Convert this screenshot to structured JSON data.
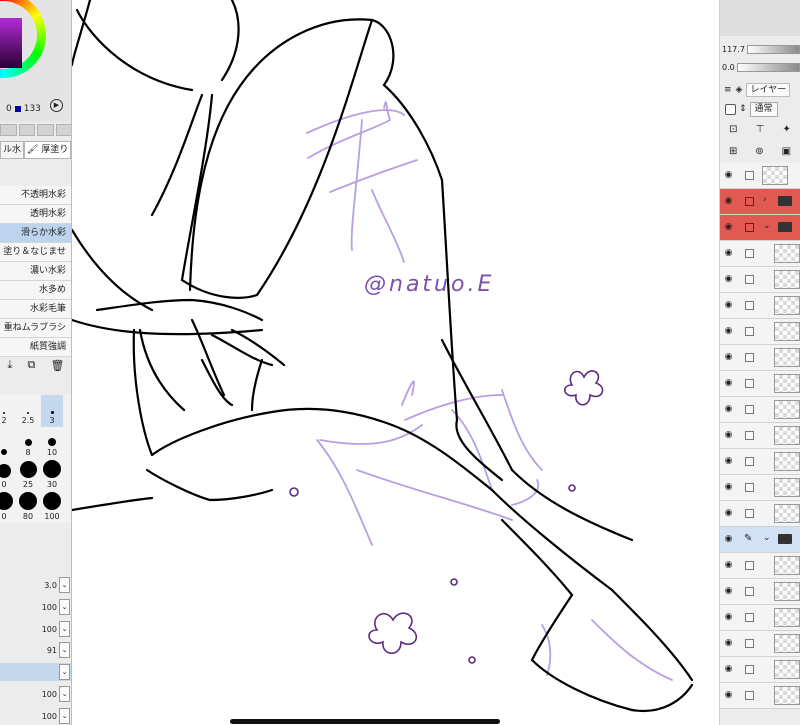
{
  "color_panel": {
    "value_left": "0",
    "value_right": "133",
    "hue_color": "#b22bd6"
  },
  "brush_types": [
    "ル水",
    "厚塗り"
  ],
  "brushes": [
    {
      "label": "不透明水彩",
      "selected": false
    },
    {
      "label": "透明水彩",
      "selected": false
    },
    {
      "label": "滑らか水彩",
      "selected": true
    },
    {
      "label": "塗り＆なじませ",
      "selected": false
    },
    {
      "label": "濃い水彩",
      "selected": false
    },
    {
      "label": "水多め",
      "selected": false
    },
    {
      "label": "水彩毛筆",
      "selected": false
    },
    {
      "label": "重ねムラブラシ",
      "selected": false
    },
    {
      "label": "紙質強調",
      "selected": false
    }
  ],
  "brush_sizes": [
    {
      "label": "2",
      "selected": false
    },
    {
      "label": "2.5",
      "selected": false
    },
    {
      "label": "3",
      "selected": true
    },
    {
      "label": "",
      "selected": false
    },
    {
      "label": "8",
      "selected": false
    },
    {
      "label": "10",
      "selected": false
    },
    {
      "label": "0",
      "selected": false
    },
    {
      "label": "25",
      "selected": false
    },
    {
      "label": "30",
      "selected": false
    },
    {
      "label": "0",
      "selected": false
    },
    {
      "label": "80",
      "selected": false
    },
    {
      "label": "100",
      "selected": false
    }
  ],
  "tool_props": [
    {
      "value": "3.0",
      "selected": false
    },
    {
      "value": "100",
      "selected": false
    },
    {
      "value": "100",
      "selected": false
    },
    {
      "value": "91",
      "selected": false
    },
    {
      "value": "",
      "selected": true
    },
    {
      "value": "100",
      "selected": false
    },
    {
      "value": "100",
      "selected": false
    }
  ],
  "canvas": {
    "watermark": "@natuo.E",
    "line_color": "#000000",
    "sketch_color": "#b89ee3",
    "flower_color": "#5a2d82"
  },
  "right_panel": {
    "slider_1": "117.7",
    "slider_2": "0.0",
    "layer_tab": "レイヤー",
    "blend_mode": "通常"
  },
  "layers": [
    {
      "kind": "layer",
      "red": false,
      "selected": false
    },
    {
      "kind": "folder-closed",
      "red": true,
      "selected": false
    },
    {
      "kind": "folder-open",
      "red": true,
      "selected": false
    },
    {
      "kind": "layer",
      "red": false,
      "selected": false
    },
    {
      "kind": "layer",
      "red": false,
      "selected": false
    },
    {
      "kind": "layer",
      "red": false,
      "selected": false
    },
    {
      "kind": "layer",
      "red": false,
      "selected": false
    },
    {
      "kind": "layer",
      "red": false,
      "selected": false
    },
    {
      "kind": "layer",
      "red": false,
      "selected": false
    },
    {
      "kind": "layer",
      "red": false,
      "selected": false
    },
    {
      "kind": "layer",
      "red": false,
      "selected": false
    },
    {
      "kind": "layer",
      "red": false,
      "selected": false
    },
    {
      "kind": "layer",
      "red": false,
      "selected": false
    },
    {
      "kind": "layer",
      "red": false,
      "selected": false
    },
    {
      "kind": "folder-open",
      "red": false,
      "selected": true
    },
    {
      "kind": "layer",
      "red": false,
      "selected": false
    },
    {
      "kind": "layer",
      "red": false,
      "selected": false
    },
    {
      "kind": "layer",
      "red": false,
      "selected": false
    },
    {
      "kind": "layer",
      "red": false,
      "selected": false
    },
    {
      "kind": "layer",
      "red": false,
      "selected": false
    },
    {
      "kind": "layer",
      "red": false,
      "selected": false
    }
  ]
}
